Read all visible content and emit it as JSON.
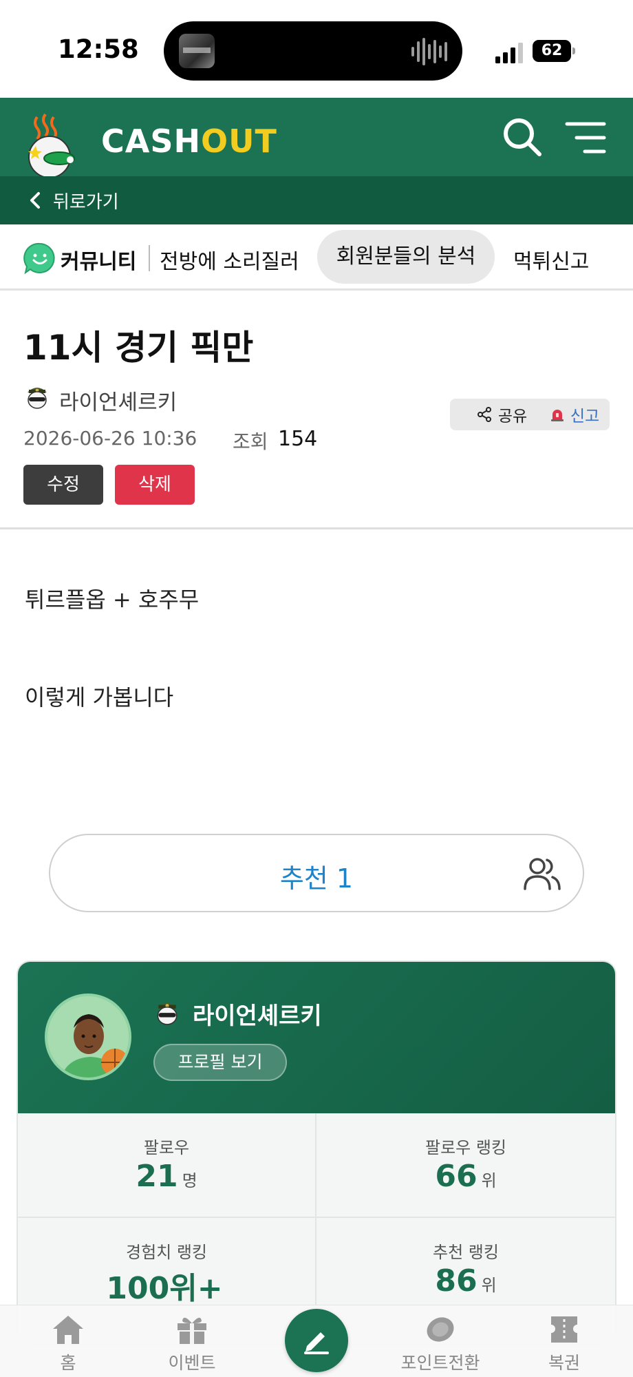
{
  "status_bar": {
    "time": "12:58",
    "battery": "62"
  },
  "header": {
    "logo_cash": "CASH",
    "logo_out": "OUT",
    "back_label": "뒤로가기"
  },
  "tabs": {
    "community_label": "커뮤니티",
    "items": [
      "전방에 소리질러",
      "회원분들의 분석",
      "먹튀신고"
    ],
    "active_index": 1
  },
  "post": {
    "title": "11시 경기 픽만",
    "author": "라이언셰르키",
    "date": "2026-06-26 10:36",
    "views_label": "조회",
    "views": "154",
    "share_label": "공유",
    "report_label": "신고",
    "edit_label": "수정",
    "delete_label": "삭제",
    "body_lines": [
      "튀르플옵 + 호주무",
      "이렇게 가봅니다"
    ]
  },
  "recommend": {
    "label": "추천 1"
  },
  "profile": {
    "name": "라이언셰르키",
    "view_profile_label": "프로필 보기",
    "stats": [
      {
        "label": "팔로우",
        "value": "21",
        "unit": "명"
      },
      {
        "label": "팔로우 랭킹",
        "value": "66",
        "unit": "위"
      },
      {
        "label": "경험치 랭킹",
        "value": "100위+",
        "unit": ""
      },
      {
        "label": "추천 랭킹",
        "value": "86",
        "unit": "위"
      }
    ]
  },
  "bottom_nav": {
    "items": [
      {
        "label": "홈",
        "icon": "home-icon"
      },
      {
        "label": "이벤트",
        "icon": "gift-icon"
      },
      {
        "label": "",
        "icon": "write-icon"
      },
      {
        "label": "포인트전환",
        "icon": "coin-icon"
      },
      {
        "label": "복권",
        "icon": "ticket-icon"
      }
    ]
  },
  "colors": {
    "brand_green": "#1b7354",
    "brand_dark_green": "#115c41",
    "logo_yellow": "#f2cc1e",
    "delete_red": "#e0344b",
    "recommend_blue": "#1e84c9"
  }
}
